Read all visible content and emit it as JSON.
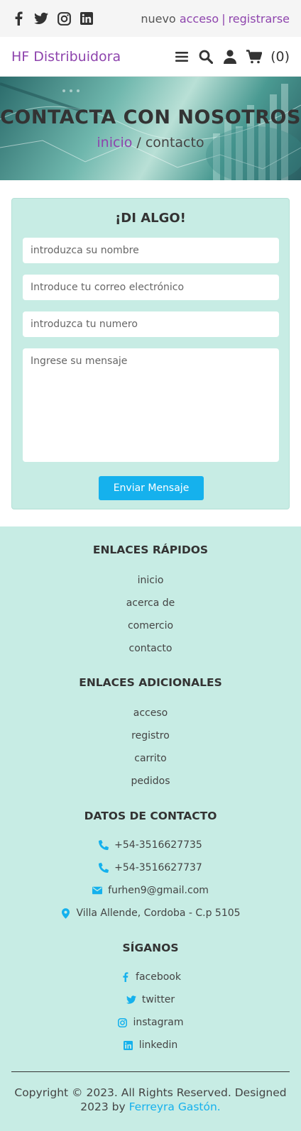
{
  "topbar": {
    "socials": [
      "facebook-icon",
      "twitter-icon",
      "instagram-icon",
      "linkedin-icon"
    ],
    "auth_prefix": "nuevo",
    "login": "acceso",
    "separator": "|",
    "register": "registrarse"
  },
  "header": {
    "brand": "HF Distribuidora",
    "icons": [
      "menu-icon",
      "search-icon",
      "user-icon",
      "cart-icon"
    ],
    "cart_count": "(0)"
  },
  "hero": {
    "title": "CONTACTA CON NOSOTROS",
    "crumb_home": "inicio",
    "crumb_sep": " / ",
    "crumb_current": "contacto"
  },
  "form": {
    "title": "¡DI ALGO!",
    "name_placeholder": "introduzca su nombre",
    "email_placeholder": "Introduce tu correo electrónico",
    "phone_placeholder": "introduzca tu numero",
    "message_placeholder": "Ingrese su mensaje",
    "submit": "Enviar Mensaje"
  },
  "footer": {
    "quick_title": "ENLACES RÁPIDOS",
    "quick_links": [
      "inicio",
      "acerca de",
      "comercio",
      "contacto"
    ],
    "extra_title": "ENLACES ADICIONALES",
    "extra_links": [
      "acceso",
      "registro",
      "carrito",
      "pedidos"
    ],
    "contact_title": "DATOS DE CONTACTO",
    "contacts": [
      {
        "icon": "phone-icon",
        "text": "+54-3516627735"
      },
      {
        "icon": "phone-icon",
        "text": "+54-3516627737"
      },
      {
        "icon": "envelope-icon",
        "text": "furhen9@gmail.com"
      },
      {
        "icon": "map-marker-icon",
        "text": "Villa Allende, Cordoba - C.p 5105"
      }
    ],
    "follow_title": "SÍGANOS",
    "follow": [
      {
        "icon": "facebook-icon",
        "text": "facebook"
      },
      {
        "icon": "twitter-icon",
        "text": "twitter"
      },
      {
        "icon": "instagram-icon",
        "text": "instagram"
      },
      {
        "icon": "linkedin-icon",
        "text": "linkedin"
      }
    ],
    "copyright": "Copyright © 2023. All Rights Reserved. Designed 2023 by",
    "author": "Ferreyra Gastón."
  },
  "colors": {
    "accent_purple": "#8e44ad",
    "accent_blue": "#15b1ed",
    "mint": "#c7ece4"
  }
}
